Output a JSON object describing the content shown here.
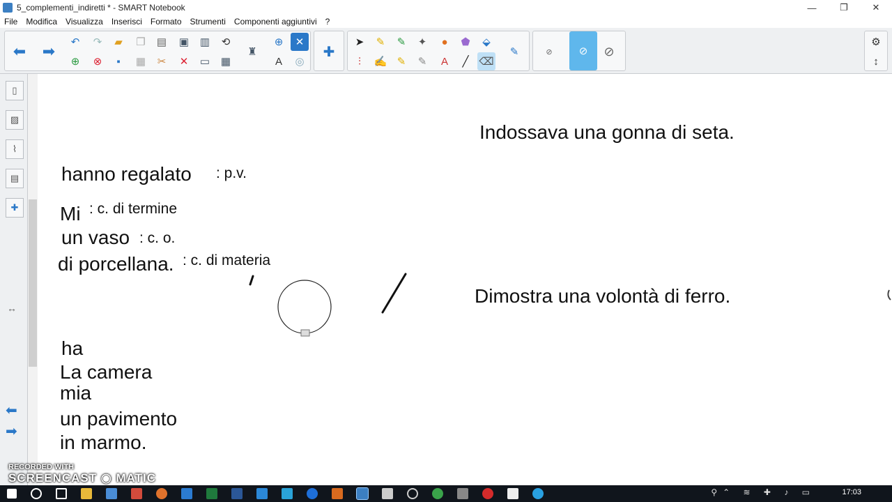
{
  "window": {
    "title": "5_complementi_indiretti * - SMART Notebook",
    "controls": {
      "minimize": "—",
      "restore": "❐",
      "close": "✕"
    }
  },
  "menu": [
    "File",
    "Modifica",
    "Visualizza",
    "Inserisci",
    "Formato",
    "Strumenti",
    "Componenti aggiuntivi",
    "?"
  ],
  "toolbar": {
    "nav_back_icon": "arrow-left-icon",
    "nav_forward_icon": "arrow-right-icon",
    "selected_tool": "eraser",
    "eraser_size_selected": 2,
    "accent_color": "#2a78c8",
    "selected_color": "#bfe0f6"
  },
  "sidebar": {
    "tabs": [
      "page-sorter-icon",
      "gallery-icon",
      "attachments-icon",
      "properties-icon",
      "addons-icon"
    ],
    "resize_glyph": "↔",
    "nav_prev": "⬅",
    "nav_next": "➡"
  },
  "canvas": {
    "sentence1": {
      "line_a": "hanno regalato",
      "note_a": ": p.v.",
      "line_b": "Mi",
      "note_b": ": c. di termine",
      "line_c": "un vaso",
      "note_c": ": c. o.",
      "line_d": "di porcellana.",
      "note_d": ": c. di materia"
    },
    "sentence2": [
      "ha",
      "La camera",
      "mia",
      "un pavimento",
      "in marmo."
    ],
    "right_sentences": [
      "Indossava  una gonna di seta.",
      "Dimostra una volontà di ferro."
    ]
  },
  "taskbar": {
    "time": "17:03"
  },
  "watermark": {
    "line1": "RECORDED WITH",
    "line2": "SCREENCAST",
    "line3": "MATIC"
  }
}
